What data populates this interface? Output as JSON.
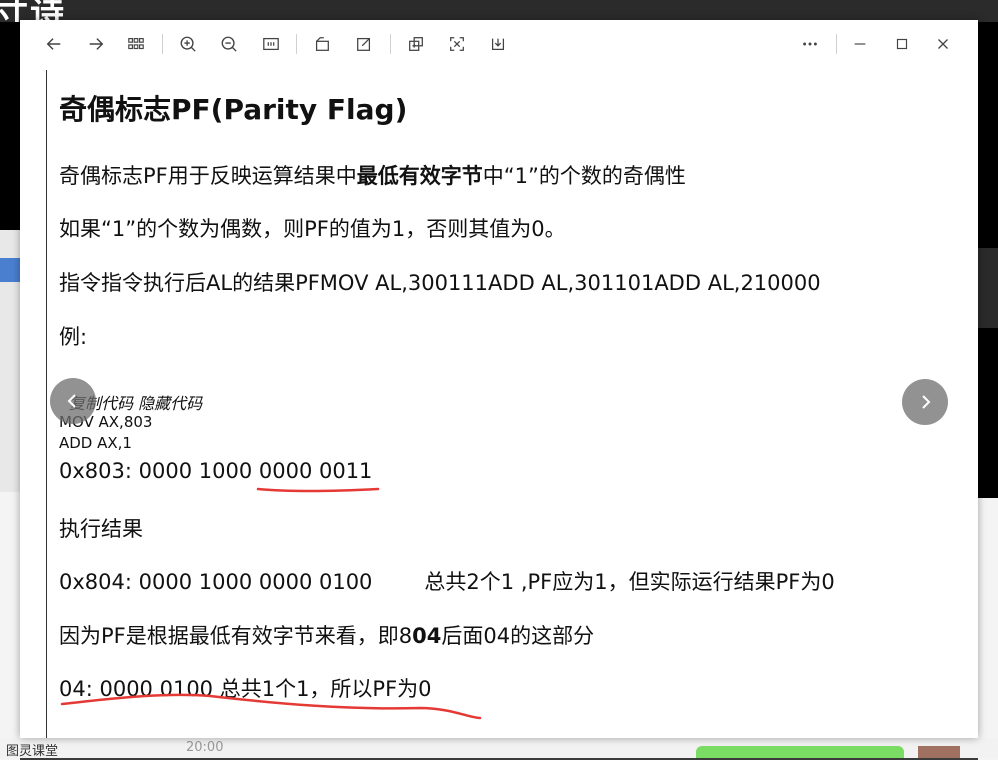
{
  "background": {
    "title_fragment": "寸诗",
    "bottom_left_text": "图灵课堂",
    "bottom_time": "20:00"
  },
  "toolbar": {
    "icons": [
      "back-arrow-icon",
      "forward-arrow-icon",
      "grid-icon",
      "zoom-in-icon",
      "zoom-out-icon",
      "fit-icon",
      "rotate-icon",
      "edit-icon",
      "crop-icon",
      "ocr-icon",
      "download-icon",
      "more-icon",
      "minimize-icon",
      "maximize-icon",
      "close-icon"
    ]
  },
  "doc": {
    "title": "奇偶标志PF(Parity  Flag)",
    "line1_a": "奇偶标志PF用于反映运算结果中",
    "line1_b": "最低有效字节",
    "line1_c": "中“1”的个数的奇偶性",
    "line2": "如果“1”的个数为偶数，则PF的值为1，否则其值为0。",
    "line3": "指令指令执行后AL的结果PFMOV AL,300111ADD AL,301101ADD AL,210000",
    "line4": "例:",
    "code_hint": "复制代码 隐藏代码",
    "code1": "MOV AX,803",
    "code2": "ADD AX,1",
    "line5": "0x803: 0000 1000 0000 0011",
    "line6": "执行结果",
    "line7_a": "0x804: 0000 1000 0000 0100",
    "line7_b": "总共2个1 ,PF应为1，但实际运行结果PF为0",
    "line8_a": "因为PF是根据最低有效字节来看，即8",
    "line8_b": "04",
    "line8_c": "后面04的这部分",
    "line9": "04:   0000 0100 总共1个1，所以PF为0"
  },
  "colors": {
    "ink": "#e53935",
    "nav_button": "#8a8a8a"
  }
}
